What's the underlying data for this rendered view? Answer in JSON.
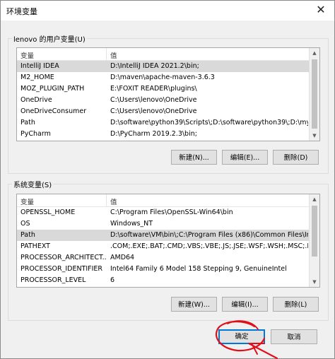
{
  "window": {
    "title": "环境变量",
    "close_glyph": "✕"
  },
  "user_section": {
    "label": "lenovo 的用户变量(U)",
    "columns": [
      "变量",
      "值"
    ],
    "rows": [
      {
        "name": "IntelliJ IDEA",
        "value": "D:\\IntelliJ IDEA 2021.2\\bin;"
      },
      {
        "name": "M2_HOME",
        "value": "D:\\maven\\apache-maven-3.6.3"
      },
      {
        "name": "MOZ_PLUGIN_PATH",
        "value": "E:\\FOXIT READER\\plugins\\"
      },
      {
        "name": "OneDrive",
        "value": "C:\\Users\\lenovo\\OneDrive"
      },
      {
        "name": "OneDriveConsumer",
        "value": "C:\\Users\\lenovo\\OneDrive"
      },
      {
        "name": "Path",
        "value": "D:\\software\\python39\\Scripts\\;D:\\software\\python39\\;D:\\mys..."
      },
      {
        "name": "PyCharm",
        "value": "D:\\PyCharm 2019.2.3\\bin;"
      }
    ],
    "selected_index": 0,
    "buttons": {
      "new": "新建(N)...",
      "edit": "编辑(E)...",
      "delete": "删除(D)"
    }
  },
  "system_section": {
    "label": "系统变量(S)",
    "columns": [
      "变量",
      "值"
    ],
    "rows": [
      {
        "name": "OPENSSL_HOME",
        "value": "C:\\Program Files\\OpenSSL-Win64\\bin"
      },
      {
        "name": "OS",
        "value": "Windows_NT"
      },
      {
        "name": "Path",
        "value": "D:\\software\\VM\\bin\\;C:\\Program Files (x86)\\Common Files\\In..."
      },
      {
        "name": "PATHEXT",
        "value": ".COM;.EXE;.BAT;.CMD;.VBS;.VBE;.JS;.JSE;.WSF;.WSH;.MSC;.PY;.P..."
      },
      {
        "name": "PROCESSOR_ARCHITECT...",
        "value": "AMD64"
      },
      {
        "name": "PROCESSOR_IDENTIFIER",
        "value": "Intel64 Family 6 Model 158 Stepping 9, GenuineIntel"
      },
      {
        "name": "PROCESSOR_LEVEL",
        "value": "6"
      }
    ],
    "selected_index": 2,
    "buttons": {
      "new": "新建(W)...",
      "edit": "编辑(I)...",
      "delete": "删除(L)"
    }
  },
  "footer": {
    "ok": "确定",
    "cancel": "取消"
  },
  "colors": {
    "selection": "#d9d9d9",
    "default_button_border": "#0078d7",
    "annotation_ink": "#e0101a"
  },
  "icons": {
    "scroll_up": "▲",
    "scroll_down": "▼"
  }
}
